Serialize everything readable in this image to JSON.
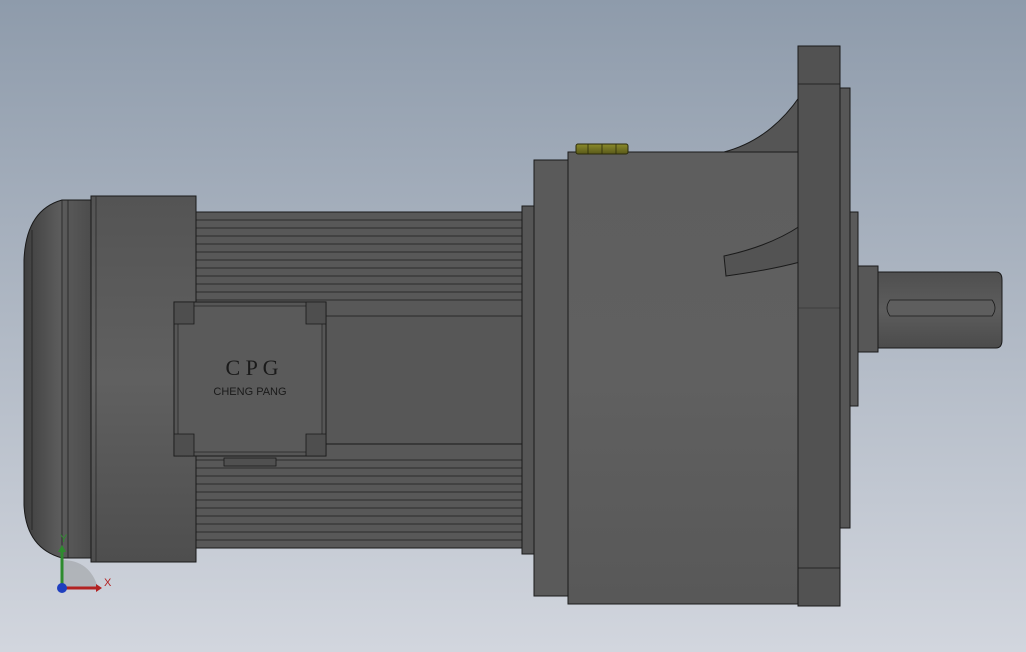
{
  "viewport": {
    "background_top": "#8e9bab",
    "background_bottom": "#d2d6de",
    "part_color": "#5a5a5a",
    "edge_color": "#1a1a1a",
    "background_style": "gradient"
  },
  "nameplate": {
    "brand": "C P G",
    "company": "CHENG PANG"
  },
  "triad": {
    "x_label": "X",
    "y_label": "Y",
    "x_color": "#b22222",
    "y_color": "#2e8b2e",
    "z_color": "#1f3fbf"
  },
  "parts": {
    "motor_end_cap": "motor-end-cap",
    "motor_body_ribbed": "ribbed-motor-housing",
    "terminal_box": "terminal-box",
    "gearbox_housing": "gearbox-housing",
    "mounting_flange": "mounting-flange",
    "output_shaft": "output-shaft",
    "oil_plug": "oil-plug"
  }
}
